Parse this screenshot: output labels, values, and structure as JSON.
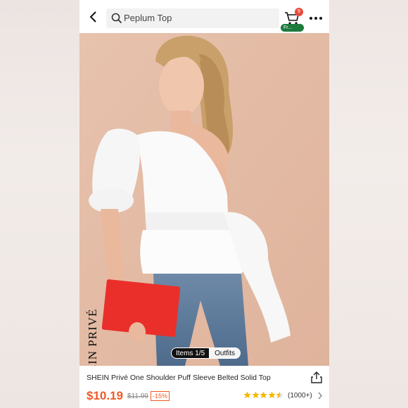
{
  "search": {
    "placeholder": "Peplum Top"
  },
  "header": {
    "cart_count": "9",
    "free_shipping": "Fr..."
  },
  "image": {
    "pager_items": "Items 1/5",
    "pager_outfits": "Outfits",
    "watermark": "SHEIN PRIVÉ"
  },
  "product": {
    "title": "SHEIN Privé One Shoulder Puff Sleeve Belted Solid Top",
    "price": "$10.19",
    "original_price": "$11.99",
    "discount": "-15%",
    "rating_stars": 4.5,
    "review_count": "(1000+)"
  },
  "colors": {
    "accent": "#f15a24",
    "badge": "#e94b3c",
    "free": "#1c7a3d",
    "star": "#f5b700"
  },
  "icons": [
    "back-arrow-icon",
    "search-icon",
    "cart-icon",
    "more-icon",
    "share-icon",
    "star-icon",
    "chevron-right-icon"
  ]
}
